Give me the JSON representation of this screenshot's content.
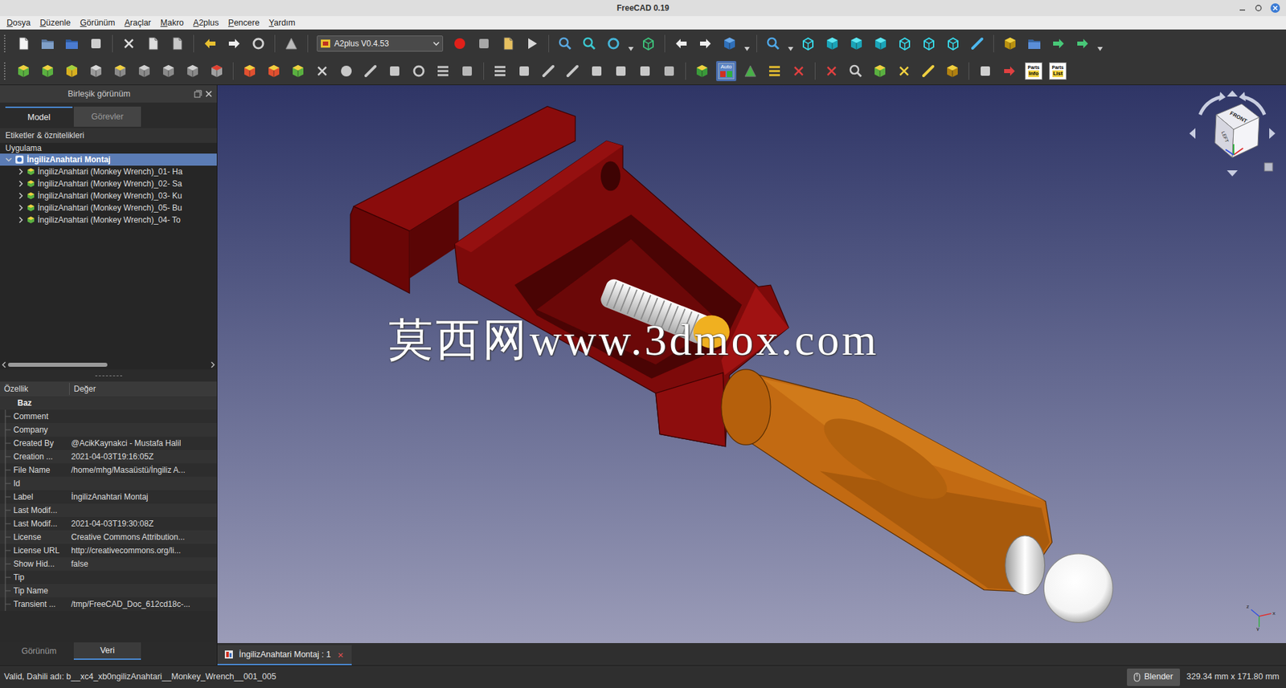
{
  "window": {
    "title": "FreeCAD 0.19"
  },
  "menu": [
    "Dosya",
    "Düzenle",
    "Görünüm",
    "Araçlar",
    "Makro",
    "A2plus",
    "Pencere",
    "Yardım"
  ],
  "workbench": {
    "value": "A2plus V0.4.53"
  },
  "toolbar": {
    "auto_button": {
      "label": "Auto",
      "on": true
    },
    "parts_buttons": [
      {
        "top": "Parts",
        "bottom": "Info"
      },
      {
        "top": "Parts",
        "bottom": "List"
      }
    ]
  },
  "combo_view": {
    "title": "Birleşik görünüm",
    "tabs": [
      {
        "label": "Model",
        "selected": true
      },
      {
        "label": "Görevler",
        "selected": false
      }
    ],
    "tree_header": "Etiketler & öznitelikleri",
    "tree_root_label": "Uygulama",
    "tree": [
      {
        "label": "İngilizAnahtari Montaj",
        "depth": 0,
        "expanded": true,
        "selected": true
      },
      {
        "label": "İngilizAnahtari (Monkey Wrench)_01- Ha",
        "depth": 1,
        "expanded": false,
        "selected": false
      },
      {
        "label": "İngilizAnahtari (Monkey Wrench)_02- Sa",
        "depth": 1,
        "expanded": false,
        "selected": false
      },
      {
        "label": "İngilizAnahtari (Monkey Wrench)_03- Ku",
        "depth": 1,
        "expanded": false,
        "selected": false
      },
      {
        "label": "İngilizAnahtari (Monkey Wrench)_05- Bu",
        "depth": 1,
        "expanded": false,
        "selected": false
      },
      {
        "label": "İngilizAnahtari (Monkey Wrench)_04- To",
        "depth": 1,
        "expanded": false,
        "selected": false
      }
    ]
  },
  "properties": {
    "columns": [
      "Özellik",
      "Değer"
    ],
    "group": "Baz",
    "rows": [
      {
        "name": "Comment",
        "value": ""
      },
      {
        "name": "Company",
        "value": ""
      },
      {
        "name": "Created By",
        "value": "@AcikKaynakci - Mustafa Halil"
      },
      {
        "name": "Creation ...",
        "value": "2021-04-03T19:16:05Z"
      },
      {
        "name": "File Name",
        "value": "/home/mhg/Masaüstü/İngiliz A..."
      },
      {
        "name": "Id",
        "value": ""
      },
      {
        "name": "Label",
        "value": "İngilizAnahtari Montaj"
      },
      {
        "name": "Last Modif...",
        "value": ""
      },
      {
        "name": "Last Modif...",
        "value": "2021-04-03T19:30:08Z"
      },
      {
        "name": "License",
        "value": "Creative Commons Attribution..."
      },
      {
        "name": "License URL",
        "value": "http://creativecommons.org/li..."
      },
      {
        "name": "Show Hid...",
        "value": "false"
      },
      {
        "name": "Tip",
        "value": ""
      },
      {
        "name": "Tip Name",
        "value": ""
      },
      {
        "name": "Transient ...",
        "value": "/tmp/FreeCAD_Doc_612cd18c-..."
      }
    ]
  },
  "bottom_tabs": [
    {
      "label": "Görünüm",
      "selected": false
    },
    {
      "label": "Veri",
      "selected": true
    }
  ],
  "viewport": {
    "watermark": "莫西网www.3dmox.com",
    "navcube_faces": [
      "FRONT",
      "LEFT"
    ],
    "axes": [
      "x",
      "y",
      "z"
    ]
  },
  "doc_tabs": [
    {
      "label": "İngilizAnahtari Montaj : 1",
      "selected": true,
      "close": "×"
    }
  ],
  "status_bar": {
    "message": "Valid, Dahili adı: b__xc4_xb0ngilizAnahtari__Monkey_Wrench__001_005",
    "nav_style": "Blender",
    "dimensions": "329.34 mm x 171.80 mm"
  }
}
